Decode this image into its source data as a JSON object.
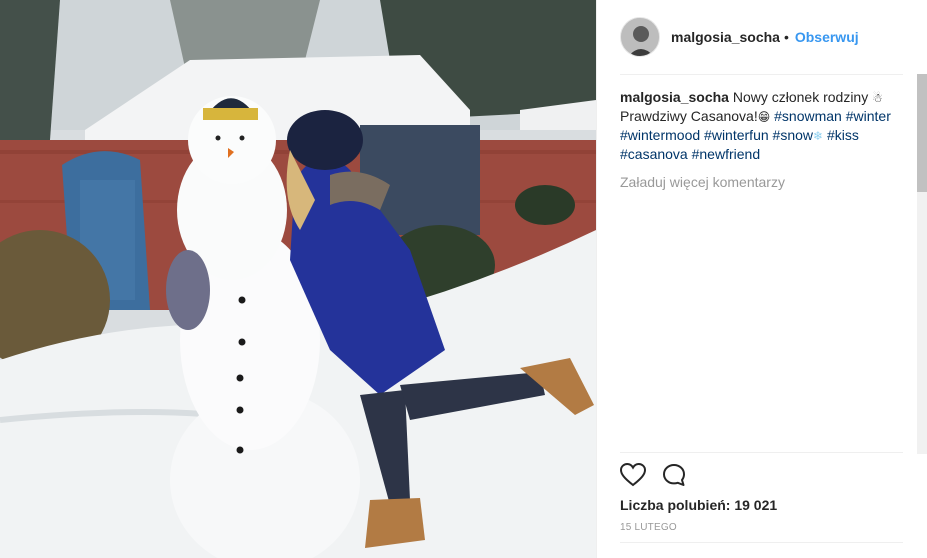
{
  "post": {
    "image_alt": "Kobieta całuje bałwana w śniegu",
    "username": "malgosia_socha",
    "separator": "•",
    "follow_label": "Obserwuj"
  },
  "caption": {
    "username": "malgosia_socha",
    "text_1": "Nowy członek rodziny",
    "emoji_snowman_1": "☃",
    "text_2": "Prawdziwy Casanova!",
    "emoji_grin": "😁",
    "hashtags": [
      "#snowman",
      "#winter",
      "#wintermood",
      "#winterfun",
      "#snow",
      "#kiss",
      "#casanova",
      "#newfriend"
    ],
    "emoji_snowflake": "❄"
  },
  "comments": {
    "load_more_label": "Załaduj więcej komentarzy"
  },
  "actions": {
    "like_icon": "heart-icon",
    "comment_icon": "comment-icon"
  },
  "likes": {
    "label": "Liczba polubień: 19 021"
  },
  "date": {
    "label": "15 LUTEGO"
  },
  "colors": {
    "link_blue": "#3897f0",
    "hashtag_blue": "#003569",
    "muted_gray": "#999999",
    "text": "#262626"
  }
}
